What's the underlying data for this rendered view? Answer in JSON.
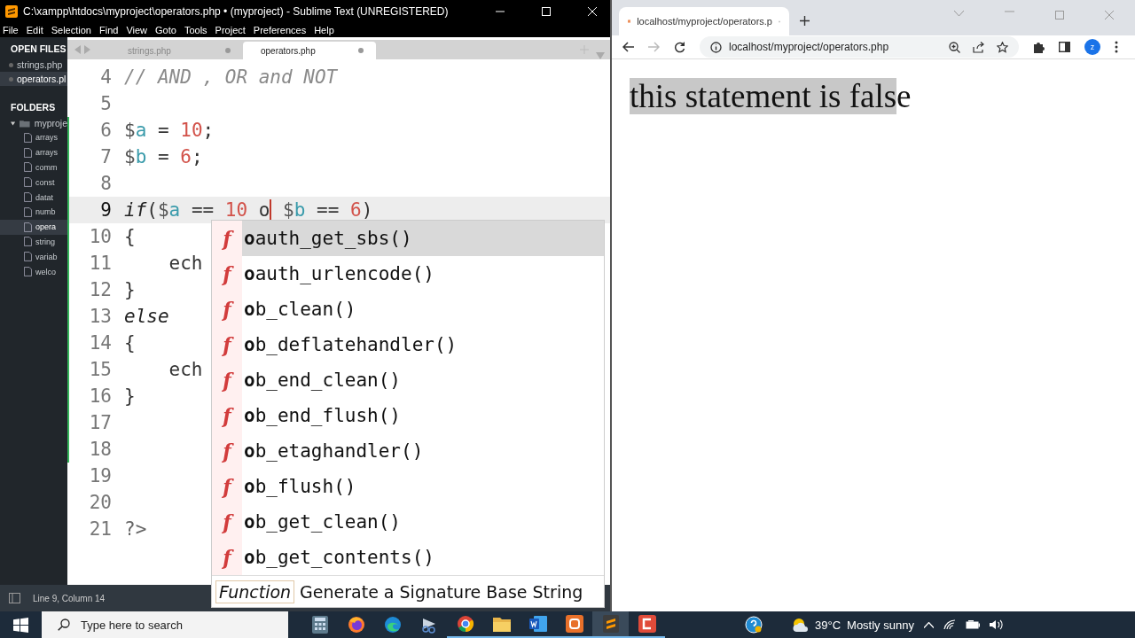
{
  "editor_window": {
    "title": "C:\\xampp\\htdocs\\myproject\\operators.php • (myproject) - Sublime Text (UNREGISTERED)",
    "menu": [
      "File",
      "Edit",
      "Selection",
      "Find",
      "View",
      "Goto",
      "Tools",
      "Project",
      "Preferences",
      "Help"
    ],
    "sidebar": {
      "open_files_heading": "OPEN FILES",
      "open_files": [
        {
          "label": "strings.php",
          "selected": false
        },
        {
          "label": "operators.pl",
          "selected": true
        }
      ],
      "folders_heading": "FOLDERS",
      "folders": [
        {
          "label": "myproje",
          "expanded": true,
          "children": [
            {
              "label": "arrays",
              "selected": false
            },
            {
              "label": "arrays",
              "selected": false
            },
            {
              "label": "comm",
              "selected": false
            },
            {
              "label": "const",
              "selected": false
            },
            {
              "label": "datat",
              "selected": false
            },
            {
              "label": "numb",
              "selected": false
            },
            {
              "label": "opera",
              "selected": true
            },
            {
              "label": "string",
              "selected": false
            },
            {
              "label": "variab",
              "selected": false
            },
            {
              "label": "welco",
              "selected": false
            }
          ]
        }
      ]
    },
    "tabs": [
      {
        "label": "strings.php",
        "selected": false
      },
      {
        "label": "operators.php",
        "selected": true
      }
    ],
    "lines": [
      {
        "number": "4",
        "current": false,
        "modified": false,
        "tokens": [
          {
            "kind": "comment",
            "text": "// AND , OR and NOT"
          }
        ]
      },
      {
        "number": "5",
        "current": false,
        "modified": false
      },
      {
        "number": "6",
        "current": false,
        "modified": true,
        "tokens": [
          {
            "kind": "sigil",
            "text": "$"
          },
          {
            "kind": "var",
            "text": "a"
          },
          {
            "kind": "plain",
            "text": " = "
          },
          {
            "kind": "num",
            "text": "10"
          },
          {
            "kind": "plain",
            "text": ";"
          }
        ]
      },
      {
        "number": "7",
        "current": false,
        "modified": true,
        "tokens": [
          {
            "kind": "sigil",
            "text": "$"
          },
          {
            "kind": "var",
            "text": "b"
          },
          {
            "kind": "plain",
            "text": " = "
          },
          {
            "kind": "num",
            "text": "6"
          },
          {
            "kind": "plain",
            "text": ";"
          }
        ]
      },
      {
        "number": "8",
        "current": false,
        "modified": true
      },
      {
        "number": "9",
        "current": true,
        "modified": true,
        "tokens": [
          {
            "kind": "kw",
            "text": "if"
          },
          {
            "kind": "plain",
            "text": "("
          },
          {
            "kind": "sigil",
            "text": "$"
          },
          {
            "kind": "var",
            "text": "a"
          },
          {
            "kind": "plain",
            "text": " == "
          },
          {
            "kind": "num",
            "text": "10"
          },
          {
            "kind": "plain",
            "text": " o",
            "caret": true
          },
          {
            "kind": "sigil",
            "text": " $"
          },
          {
            "kind": "var",
            "text": "b"
          },
          {
            "kind": "plain",
            "text": " == "
          },
          {
            "kind": "num",
            "text": "6"
          },
          {
            "kind": "plain",
            "text": ")"
          }
        ]
      },
      {
        "number": "10",
        "current": false,
        "modified": true,
        "tokens": [
          {
            "kind": "plain",
            "text": "{"
          }
        ]
      },
      {
        "number": "11",
        "current": false,
        "modified": true,
        "tokens": [
          {
            "kind": "plain",
            "text": "    ech"
          }
        ]
      },
      {
        "number": "12",
        "current": false,
        "modified": true,
        "tokens": [
          {
            "kind": "plain",
            "text": "}"
          }
        ]
      },
      {
        "number": "13",
        "current": false,
        "modified": true,
        "tokens": [
          {
            "kind": "kw",
            "text": "else"
          }
        ]
      },
      {
        "number": "14",
        "current": false,
        "modified": true,
        "tokens": [
          {
            "kind": "plain",
            "text": "{"
          }
        ]
      },
      {
        "number": "15",
        "current": false,
        "modified": true,
        "tokens": [
          {
            "kind": "plain",
            "text": "    ech"
          }
        ]
      },
      {
        "number": "16",
        "current": false,
        "modified": true,
        "tokens": [
          {
            "kind": "plain",
            "text": "}"
          }
        ]
      },
      {
        "number": "17",
        "current": false,
        "modified": true
      },
      {
        "number": "18",
        "current": false,
        "modified": true
      },
      {
        "number": "19",
        "current": false,
        "modified": false
      },
      {
        "number": "20",
        "current": false,
        "modified": false
      },
      {
        "number": "21",
        "current": false,
        "modified": false,
        "tokens": [
          {
            "kind": "tag",
            "text": "?>"
          }
        ]
      }
    ],
    "autocomplete": {
      "items": [
        {
          "icon": "f",
          "label": "**o**auth_get_sbs()",
          "selected": true
        },
        {
          "icon": "f",
          "label": "**o**auth_urlencode()",
          "selected": false
        },
        {
          "icon": "f",
          "label": "**o**b_clean()",
          "selected": false
        },
        {
          "icon": "f",
          "label": "**o**b_deflatehandler()",
          "selected": false
        },
        {
          "icon": "f",
          "label": "**o**b_end_clean()",
          "selected": false
        },
        {
          "icon": "f",
          "label": "**o**b_end_flush()",
          "selected": false
        },
        {
          "icon": "f",
          "label": "**o**b_etaghandler()",
          "selected": false
        },
        {
          "icon": "f",
          "label": "**o**b_flush()",
          "selected": false
        },
        {
          "icon": "f",
          "label": "**o**b_get_clean()",
          "selected": false
        },
        {
          "icon": "f",
          "label": "**o**b_get_contents()",
          "selected": false
        }
      ],
      "kind_label": "Function",
      "description": "Generate a Signature Base String"
    },
    "status_bar": "Line 9, Column 14"
  },
  "browser": {
    "tab_title": "localhost/myproject/operators.p",
    "url": "localhost/myproject/operators.php",
    "profile": "z",
    "page_text": [
      {
        "text": "this statement is fals",
        "selected": true
      },
      {
        "text": "e",
        "selected": false
      }
    ]
  },
  "taskbar": {
    "search_placeholder": "Type here to search",
    "apps": [
      {
        "kind": "calculator",
        "running": false,
        "active": false
      },
      {
        "kind": "firefox",
        "running": false,
        "active": false
      },
      {
        "kind": "edge",
        "running": false,
        "active": false
      },
      {
        "kind": "snip",
        "running": false,
        "active": false
      },
      {
        "kind": "chrome",
        "running": true,
        "active": false
      },
      {
        "kind": "folder",
        "running": true,
        "active": false
      },
      {
        "kind": "word",
        "running": true,
        "active": false
      },
      {
        "kind": "xampp",
        "running": true,
        "active": false
      },
      {
        "kind": "sublime",
        "running": true,
        "active": true
      },
      {
        "kind": "recorder",
        "running": true,
        "active": false
      }
    ],
    "weather": {
      "temp": "39°C",
      "condition": "Mostly sunny"
    }
  }
}
